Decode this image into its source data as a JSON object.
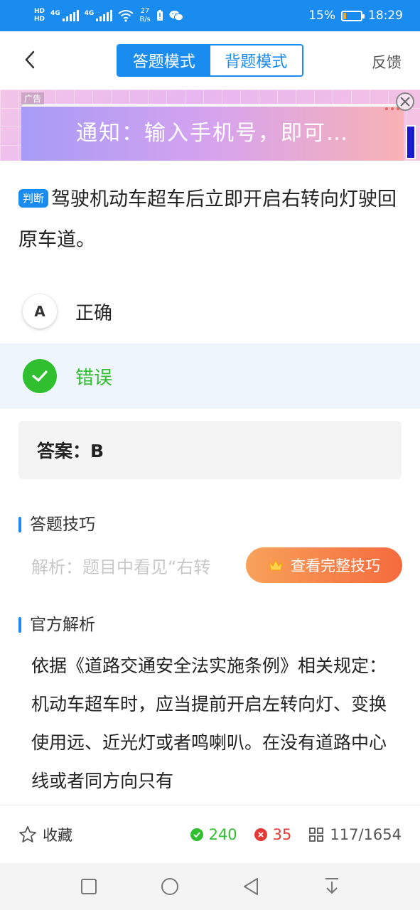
{
  "status_bar": {
    "hd_top": "HD",
    "hd_bottom": "HD",
    "signal1": "4G",
    "signal2": "4G",
    "net_speed_value": "27",
    "net_speed_unit": "B/s",
    "battery_percent": "15%",
    "battery_level": 0.15,
    "time": "18:29"
  },
  "header": {
    "mode_answer": "答题模式",
    "mode_memorize": "背题模式",
    "feedback": "反馈"
  },
  "ad": {
    "label": "广告",
    "text": "通知：输入手机号，即可…"
  },
  "question": {
    "type_tag": "判断",
    "text": "驾驶机动车超车后立即开启右转向灯驶回原车道。"
  },
  "options": [
    {
      "letter": "A",
      "text": "正确",
      "state": "normal"
    },
    {
      "letter": "B",
      "text": "错误",
      "state": "correct"
    }
  ],
  "answer": {
    "text": "答案：B"
  },
  "tips": {
    "title": "答题技巧",
    "preview": "解析：题目中看见“右转",
    "button": "查看完整技巧"
  },
  "official": {
    "title": "官方解析",
    "text": "依据《道路交通安全法实施条例》相关规定：机动车超车时，应当提前开启左转向灯、变换使用远、近光灯或者鸣喇叭。在没有道路中心线或者同方向只有"
  },
  "bottom": {
    "favorite": "收藏",
    "right_count": "240",
    "wrong_count": "35",
    "progress": "117/1654"
  },
  "colors": {
    "primary": "#1a8cf0",
    "correct": "#2fbf2f",
    "wrong": "#e53935",
    "tips_button": "#f56a3e"
  }
}
